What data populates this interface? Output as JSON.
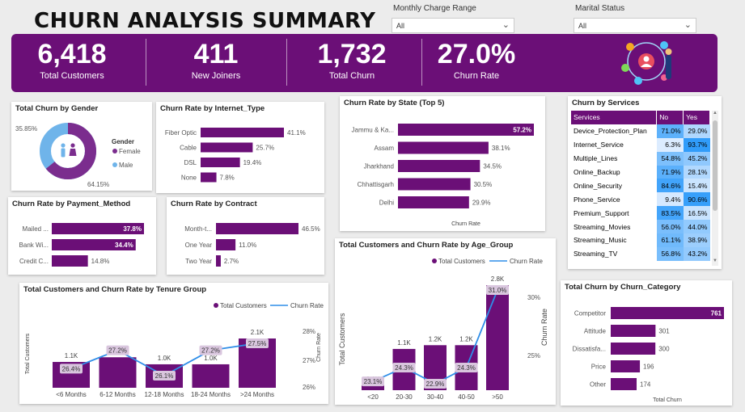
{
  "page_title": "CHURN ANALYSIS SUMMARY",
  "filters": {
    "monthly_charge": {
      "label": "Monthly Charge Range",
      "value": "All"
    },
    "marital_status": {
      "label": "Marital Status",
      "value": "All"
    }
  },
  "kpis": [
    {
      "value": "6,418",
      "label": "Total Customers"
    },
    {
      "value": "411",
      "label": "New Joiners"
    },
    {
      "value": "1,732",
      "label": "Total Churn"
    },
    {
      "value": "27.0%",
      "label": "Churn Rate"
    }
  ],
  "colors": {
    "primary": "#6b0f77",
    "line": "#2f8ee8",
    "label_bg": "#d9c6de"
  },
  "chart_data": [
    {
      "id": "gender",
      "type": "pie",
      "title": "Total Churn by Gender",
      "legend_title": "Gender",
      "slices": [
        {
          "name": "Female",
          "value": 64.15,
          "label": "64.15%",
          "color": "#7b2d8e"
        },
        {
          "name": "Male",
          "value": 35.85,
          "label": "35.85%",
          "color": "#6fb4ea"
        }
      ]
    },
    {
      "id": "internet",
      "type": "bar",
      "title": "Churn Rate by Internet_Type",
      "categories": [
        "Fiber Optic",
        "Cable",
        "DSL",
        "None"
      ],
      "values": [
        41.1,
        25.7,
        19.4,
        7.8
      ],
      "labels": [
        "41.1%",
        "25.7%",
        "19.4%",
        "7.8%"
      ]
    },
    {
      "id": "state",
      "type": "bar",
      "title": "Churn Rate by State (Top 5)",
      "categories": [
        "Jammu & Ka...",
        "Assam",
        "Jharkhand",
        "Chhattisgarh",
        "Delhi"
      ],
      "values": [
        57.2,
        38.1,
        34.5,
        30.5,
        29.9
      ],
      "labels": [
        "57.2%",
        "38.1%",
        "34.5%",
        "30.5%",
        "29.9%"
      ],
      "xlabel": "Churn Rate"
    },
    {
      "id": "payment",
      "type": "bar",
      "title": "Churn Rate by Payment_Method",
      "categories": [
        "Mailed ...",
        "Bank Wi...",
        "Credit C..."
      ],
      "values": [
        37.8,
        34.4,
        14.8
      ],
      "labels": [
        "37.8%",
        "34.4%",
        "14.8%"
      ]
    },
    {
      "id": "contract",
      "type": "bar",
      "title": "Churn Rate by Contract",
      "categories": [
        "Month-t...",
        "One Year",
        "Two Year"
      ],
      "values": [
        46.5,
        11.0,
        2.7
      ],
      "labels": [
        "46.5%",
        "11.0%",
        "2.7%"
      ]
    },
    {
      "id": "services",
      "type": "table",
      "title": "Churn by Services",
      "columns": [
        "Services",
        "No",
        "Yes"
      ],
      "rows": [
        [
          "Device_Protection_Plan",
          "71.0%",
          "29.0%"
        ],
        [
          "Internet_Service",
          "6.3%",
          "93.7%"
        ],
        [
          "Multiple_Lines",
          "54.8%",
          "45.2%"
        ],
        [
          "Online_Backup",
          "71.9%",
          "28.1%"
        ],
        [
          "Online_Security",
          "84.6%",
          "15.4%"
        ],
        [
          "Phone_Service",
          "9.4%",
          "90.6%"
        ],
        [
          "Premium_Support",
          "83.5%",
          "16.5%"
        ],
        [
          "Streaming_Movies",
          "56.0%",
          "44.0%"
        ],
        [
          "Streaming_Music",
          "61.1%",
          "38.9%"
        ],
        [
          "Streaming_TV",
          "56.8%",
          "43.2%"
        ]
      ]
    },
    {
      "id": "tenure",
      "type": "bar",
      "title": "Total Customers and Churn Rate by Tenure Group",
      "legend": [
        "Total Customers",
        "Churn Rate"
      ],
      "categories": [
        "<6 Months",
        "6-12 Months",
        "12-18 Months",
        "18-24 Months",
        ">24 Months"
      ],
      "customers": [
        1100,
        1300,
        1000,
        1000,
        2100
      ],
      "customer_labels": [
        "1.1K",
        "1.3K",
        "1.0K",
        "1.0K",
        "2.1K"
      ],
      "churn_rate": [
        26.4,
        27.2,
        26.1,
        27.2,
        27.5
      ],
      "churn_labels": [
        "26.4%",
        "27.2%",
        "26.1%",
        "27.2%",
        "27.5%"
      ],
      "ylabel": "Total Customers",
      "y2label": "Churn Rate",
      "y2_ticks": [
        "28%",
        "27%",
        "26%"
      ]
    },
    {
      "id": "age",
      "type": "bar",
      "title": "Total Customers and Churn Rate by Age_Group",
      "legend": [
        "Total Customers",
        "Churn Rate"
      ],
      "categories": [
        "<20",
        "20-30",
        "30-40",
        "40-50",
        ">50"
      ],
      "customers": [
        100,
        1100,
        1200,
        1200,
        2800
      ],
      "customer_labels": [
        "0.1K",
        "1.1K",
        "1.2K",
        "1.2K",
        "2.8K"
      ],
      "churn_rate": [
        23.1,
        24.3,
        22.9,
        24.3,
        31.0
      ],
      "churn_labels": [
        "23.1%",
        "24.3%",
        "22.9%",
        "24.3%",
        "31.0%"
      ],
      "ylabel": "Total Customers",
      "y2label": "Churn Rate",
      "y2_ticks": [
        "30%",
        "25%"
      ]
    },
    {
      "id": "category",
      "type": "bar",
      "title": "Total Churn by Churn_Category",
      "categories": [
        "Competitor",
        "Attitude",
        "Dissatisfa...",
        "Price",
        "Other"
      ],
      "values": [
        761,
        301,
        300,
        196,
        174
      ],
      "labels": [
        "761",
        "301",
        "300",
        "196",
        "174"
      ],
      "xlabel": "Total Churn"
    }
  ]
}
